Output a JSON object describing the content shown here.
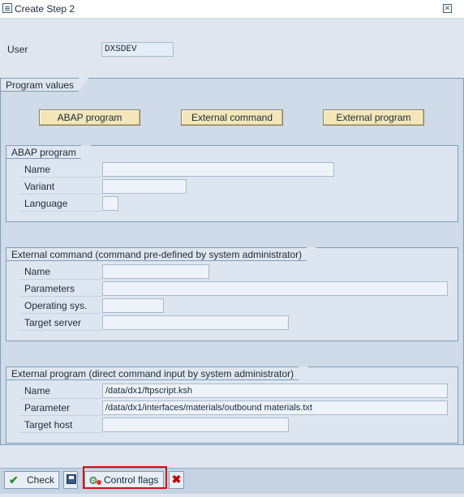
{
  "window": {
    "title": "Create Step  2"
  },
  "user": {
    "label": "User",
    "value": "DXSDEV"
  },
  "program_values": {
    "header": "Program values",
    "buttons": {
      "abap": "ABAP program",
      "external_command": "External command",
      "external_program": "External program"
    }
  },
  "abap_program": {
    "header": "ABAP program",
    "name_label": "Name",
    "name_value": "",
    "variant_label": "Variant",
    "variant_value": "",
    "language_label": "Language",
    "language_value": ""
  },
  "external_command": {
    "header": "External command (command pre-defined by system administrator)",
    "name_label": "Name",
    "name_value": "",
    "parameters_label": "Parameters",
    "parameters_value": "",
    "os_label": "Operating sys.",
    "os_value": "",
    "target_server_label": "Target server",
    "target_server_value": ""
  },
  "external_program": {
    "header": "External program (direct command input by system administrator)",
    "name_label": "Name",
    "name_value": "/data/dx1/ftpscript.ksh",
    "parameter_label": "Parameter",
    "parameter_value": "/data/dx1/interfaces/materials/outbound materials.txt",
    "target_host_label": "Target host",
    "target_host_value": ""
  },
  "toolbar": {
    "check_label": "Check",
    "control_flags_label": "Control flags"
  },
  "icons": {
    "check": "check-icon",
    "save": "save-icon",
    "control_flags": "control-flags-icon",
    "cancel": "cancel-icon",
    "close": "close-icon"
  },
  "colors": {
    "button_bg": "#f3e6b8",
    "highlight": "#d01010",
    "cancel": "#c00000",
    "check": "#2e8b2e"
  }
}
